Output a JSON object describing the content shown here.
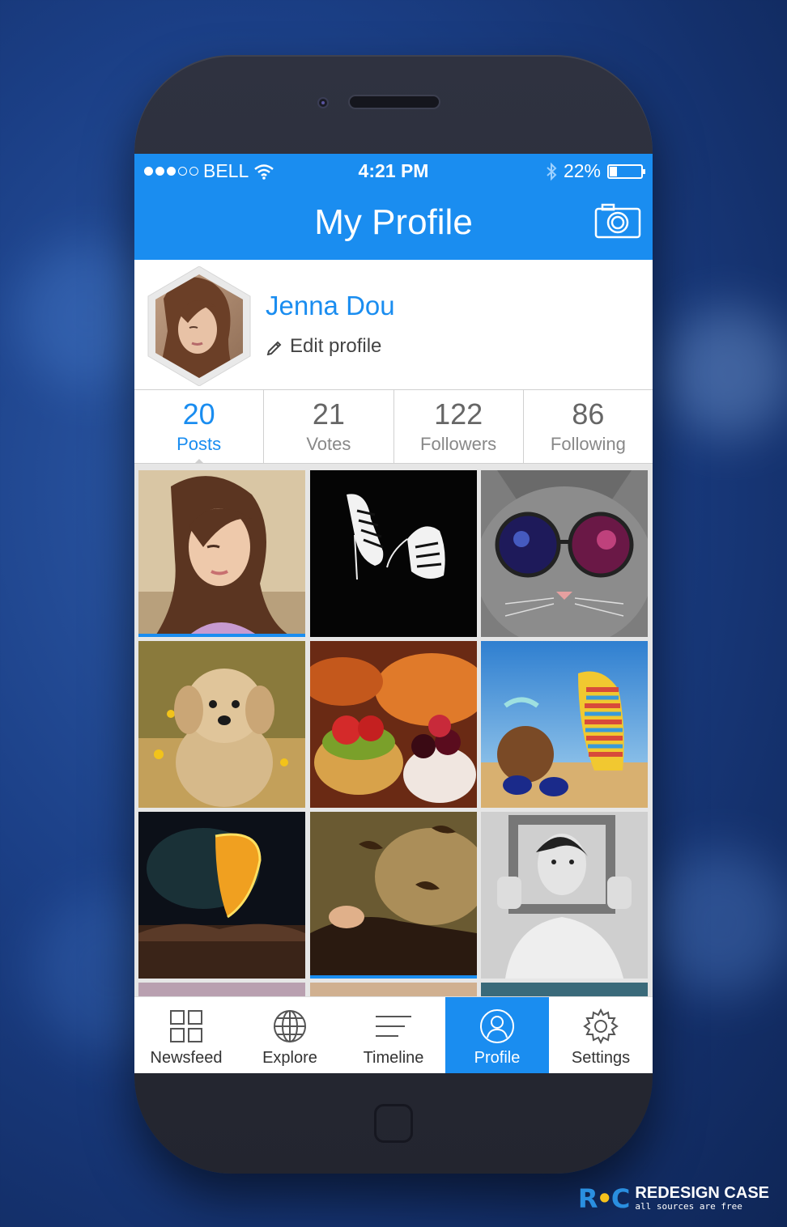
{
  "status_bar": {
    "carrier": "BELL",
    "time": "4:21 PM",
    "battery": "22%",
    "battery_level": 0.22
  },
  "header": {
    "title": "My Profile"
  },
  "profile": {
    "name": "Jenna Dou",
    "edit_label": "Edit profile"
  },
  "stats": [
    {
      "value": "20",
      "label": "Posts"
    },
    {
      "value": "21",
      "label": "Votes"
    },
    {
      "value": "122",
      "label": "Followers"
    },
    {
      "value": "86",
      "label": "Following"
    }
  ],
  "tabs": [
    {
      "label": "Newsfeed",
      "icon": "grid-icon"
    },
    {
      "label": "Explore",
      "icon": "globe-icon"
    },
    {
      "label": "Timeline",
      "icon": "lines-icon"
    },
    {
      "label": "Profile",
      "icon": "user-icon"
    },
    {
      "label": "Settings",
      "icon": "gear-icon"
    }
  ],
  "photos": [
    "woman-portrait",
    "sneakers",
    "cat-sunglasses",
    "puppy",
    "fruit-tarts",
    "beach-flipflops",
    "glowing-leaf",
    "birds-hand",
    "woman-frame"
  ],
  "brand": {
    "name": "REDESIGN CASE",
    "tagline": "all sources are free"
  },
  "colors": {
    "accent": "#1a8df0",
    "phone_body": "#2a2c38"
  }
}
